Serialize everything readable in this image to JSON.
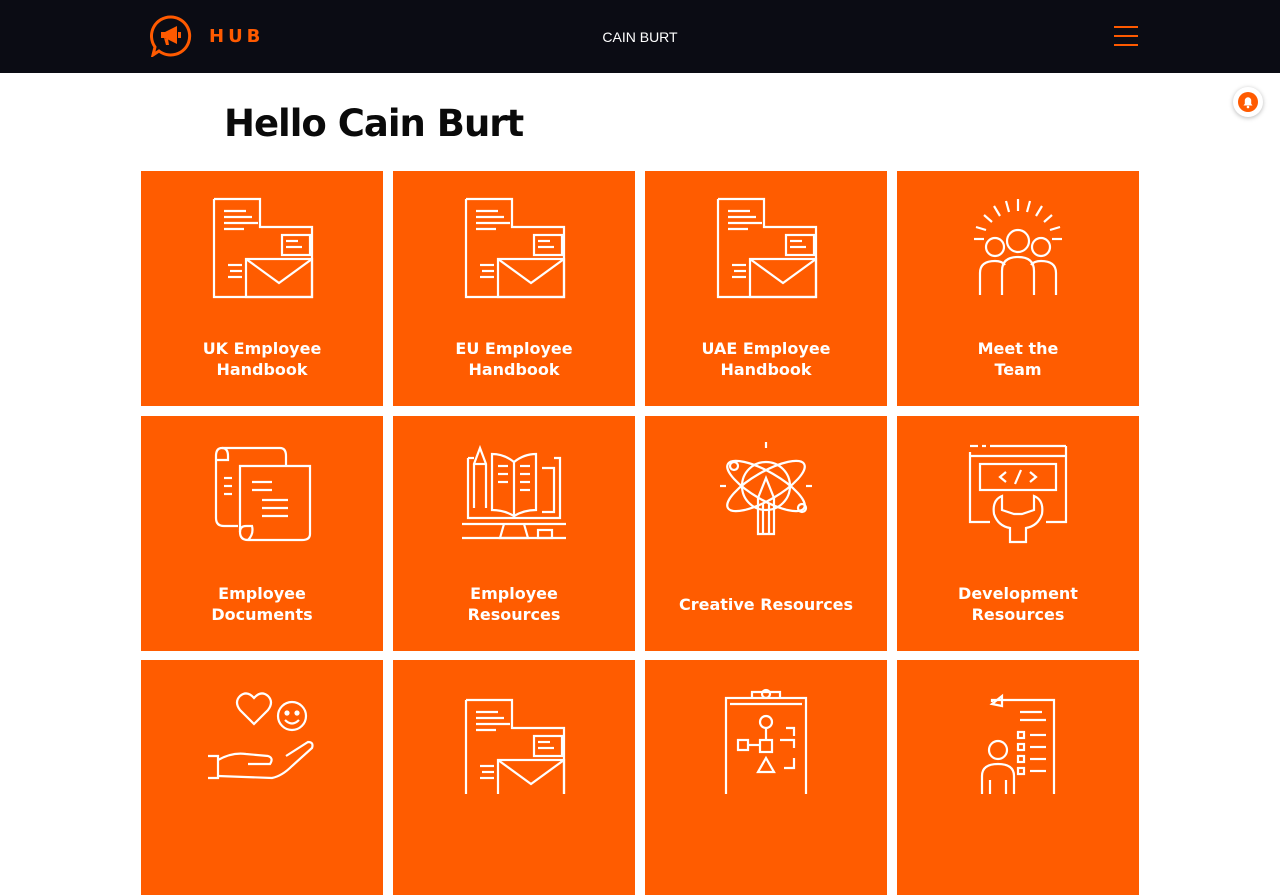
{
  "header": {
    "brand": "HUB",
    "user_name": "CAIN BURT",
    "logo_icon": "megaphone-chat-icon",
    "menu_icon": "hamburger-menu-icon",
    "accent_color": "#ff5a00",
    "background_color": "#0b0c14"
  },
  "notification": {
    "icon": "bell-icon"
  },
  "main": {
    "greeting": "Hello Cain Burt",
    "tile_color": "#ff5c00",
    "tiles": [
      {
        "line1": "UK Employee",
        "line2": "Handbook",
        "icon": "handbook-letter-icon"
      },
      {
        "line1": "EU Employee",
        "line2": "Handbook",
        "icon": "handbook-letter-icon"
      },
      {
        "line1": "UAE Employee",
        "line2": "Handbook",
        "icon": "handbook-letter-icon"
      },
      {
        "line1": "Meet the",
        "line2": "Team",
        "icon": "team-people-icon"
      },
      {
        "line1": "Employee",
        "line2": "Documents",
        "icon": "scroll-document-icon"
      },
      {
        "line1": "Employee",
        "line2": "Resources",
        "icon": "book-computer-icon"
      },
      {
        "line1": "Creative Resources",
        "line2": "",
        "icon": "atom-pencil-icon"
      },
      {
        "line1": "Development",
        "line2": "Resources",
        "icon": "code-wrench-icon"
      },
      {
        "line1": "",
        "line2": "",
        "icon": "hand-heart-smile-icon"
      },
      {
        "line1": "",
        "line2": "",
        "icon": "handbook-letter-icon"
      },
      {
        "line1": "",
        "line2": "",
        "icon": "clipboard-flowchart-icon"
      },
      {
        "line1": "",
        "line2": "",
        "icon": "person-checklist-icon"
      }
    ]
  }
}
